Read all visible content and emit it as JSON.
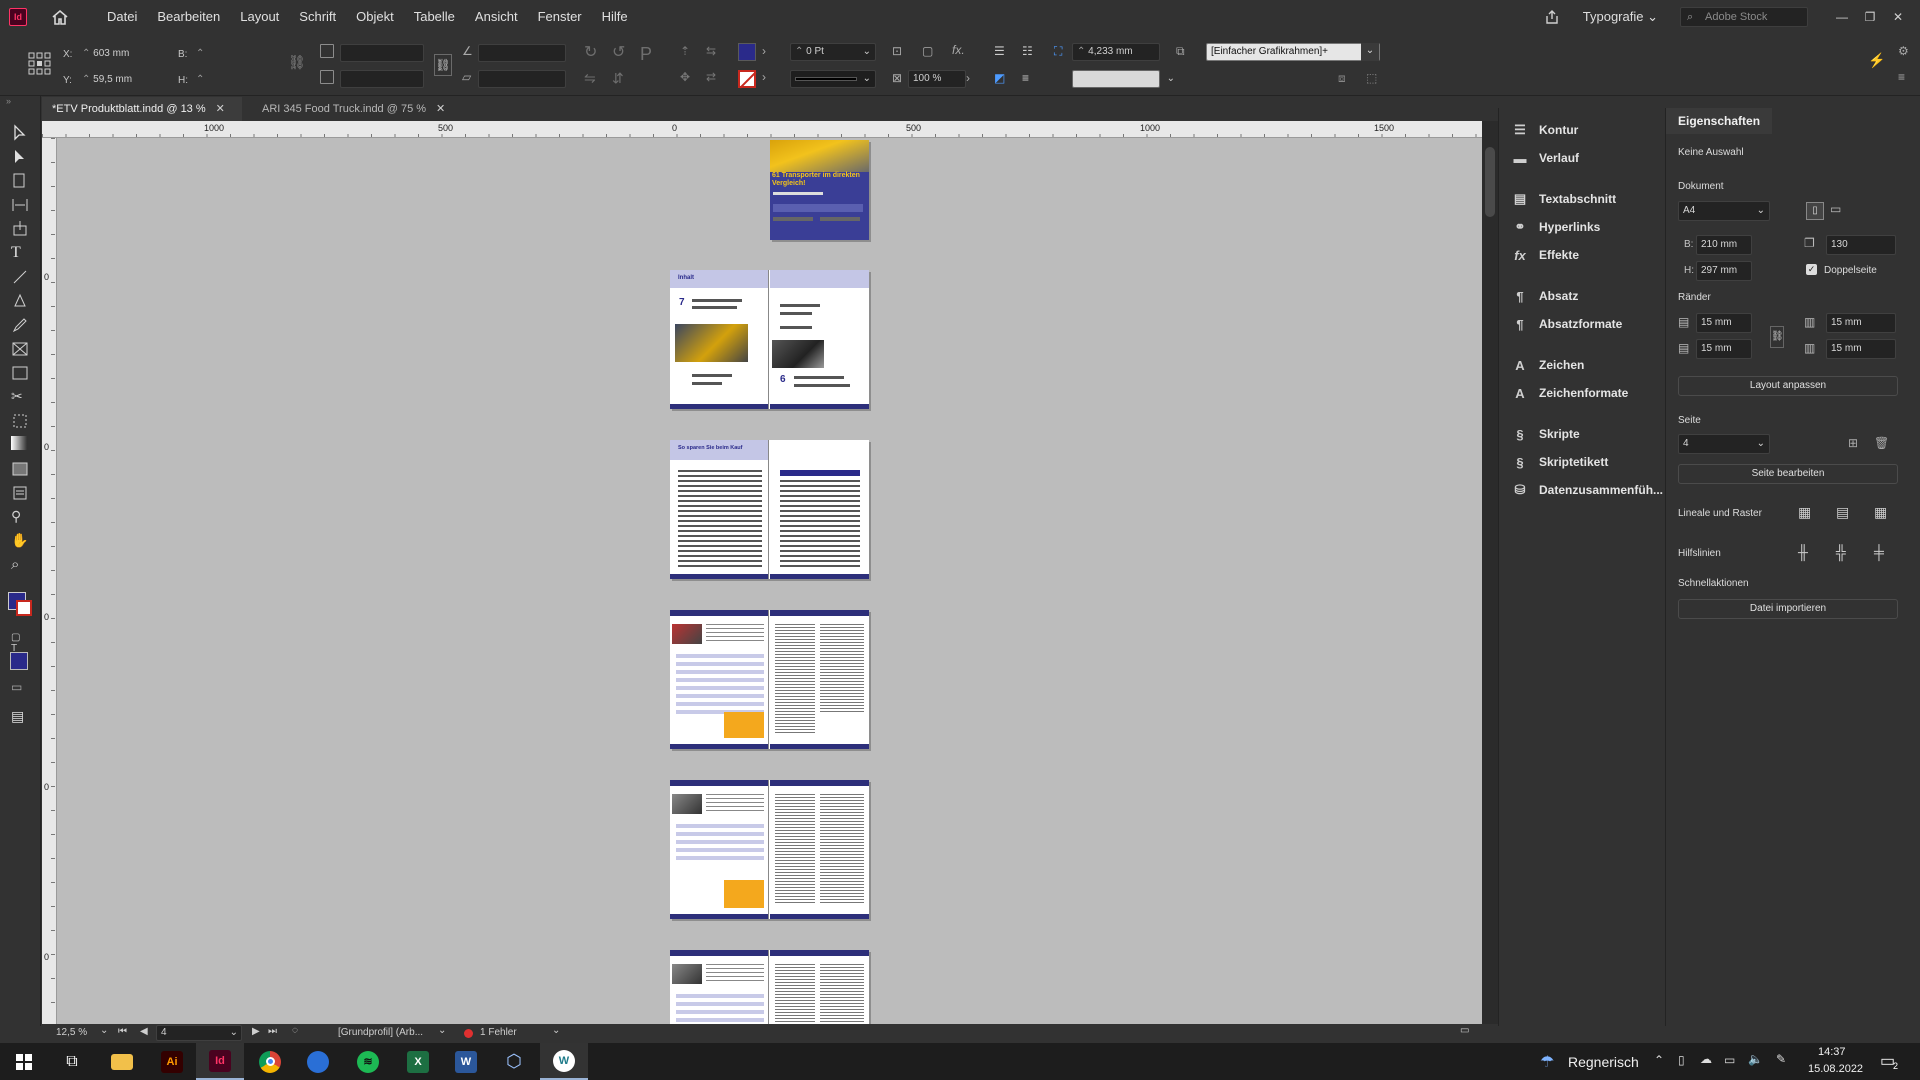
{
  "app": {
    "icon": "Id"
  },
  "menu": [
    "Datei",
    "Bearbeiten",
    "Layout",
    "Schrift",
    "Objekt",
    "Tabelle",
    "Ansicht",
    "Fenster",
    "Hilfe"
  ],
  "workspace": "Typografie",
  "stock_placeholder": "Adobe Stock",
  "control": {
    "x_label": "X:",
    "x": "603 mm",
    "y_label": "Y:",
    "y": "59,5 mm",
    "w_label": "B:",
    "h_label": "H:",
    "stroke": "0 Pt",
    "scale": "100 %",
    "gap": "4,233 mm",
    "frame_style": "[Einfacher Grafikrahmen]+"
  },
  "tabs": [
    {
      "label": "*ETV Produktblatt.indd @ 13 %"
    },
    {
      "label": "ARI 345 Food Truck.indd @ 75 %"
    }
  ],
  "ruler": {
    "ticks": [
      "1000",
      "500",
      "0",
      "500",
      "1000",
      "1500"
    ],
    "vticks": [
      "0",
      "0",
      "0",
      "0",
      "0"
    ]
  },
  "pages": {
    "cover_title": "61 Transporter im direkten Vergleich!",
    "toc_title": "Inhalt",
    "toc_num_left": "7",
    "toc_num_right": "6",
    "sparen_title": "So sparen Sie beim Kauf"
  },
  "status": {
    "zoom": "12,5 %",
    "page": "4",
    "profile": "[Grundprofil] (Arb...",
    "errors": "1 Fehler"
  },
  "panelA": [
    {
      "icon": "stroke-icon",
      "label": "Kontur"
    },
    {
      "icon": "gradient-icon",
      "label": "Verlauf"
    },
    {
      "icon": "story-icon",
      "label": "Textabschnitt"
    },
    {
      "icon": "hyperlink-icon",
      "label": "Hyperlinks"
    },
    {
      "icon": "effects-icon",
      "label": "Effekte"
    },
    {
      "icon": "paragraph-icon",
      "label": "Absatz"
    },
    {
      "icon": "paragraph-styles-icon",
      "label": "Absatzformate"
    },
    {
      "icon": "character-icon",
      "label": "Zeichen"
    },
    {
      "icon": "character-styles-icon",
      "label": "Zeichenformate"
    },
    {
      "icon": "scripts-icon",
      "label": "Skripte"
    },
    {
      "icon": "script-label-icon",
      "label": "Skriptetikett"
    },
    {
      "icon": "data-merge-icon",
      "label": "Datenzusammenfüh..."
    }
  ],
  "props": {
    "tab": "Eigenschaften",
    "no_selection": "Keine Auswahl",
    "document_label": "Dokument",
    "size": "A4",
    "w_label": "B:",
    "w": "210 mm",
    "h_label": "H:",
    "h": "297 mm",
    "pages": "130",
    "facing": "Doppelseite",
    "margins_label": "Ränder",
    "m_top": "15 mm",
    "m_bottom": "15 mm",
    "m_inside": "15 mm",
    "m_outside": "15 mm",
    "adjust_layout": "Layout anpassen",
    "page_label": "Seite",
    "page": "4",
    "edit_page": "Seite bearbeiten",
    "rulers_grids": "Lineale und Raster",
    "guides": "Hilfslinien",
    "quick_actions": "Schnellaktionen",
    "import_file": "Datei importieren"
  },
  "taskbar": {
    "weather": "Regnerisch",
    "time": "14:37",
    "date": "15.08.2022",
    "notifications": "2",
    "apps": [
      "windows-start-icon",
      "task-view-icon",
      "file-explorer-icon",
      "illustrator-icon",
      "indesign-icon",
      "chrome-icon",
      "thunderbird-icon",
      "spotify-icon",
      "excel-icon",
      "word-icon",
      "3d-viewer-icon",
      "webex-icon"
    ]
  }
}
